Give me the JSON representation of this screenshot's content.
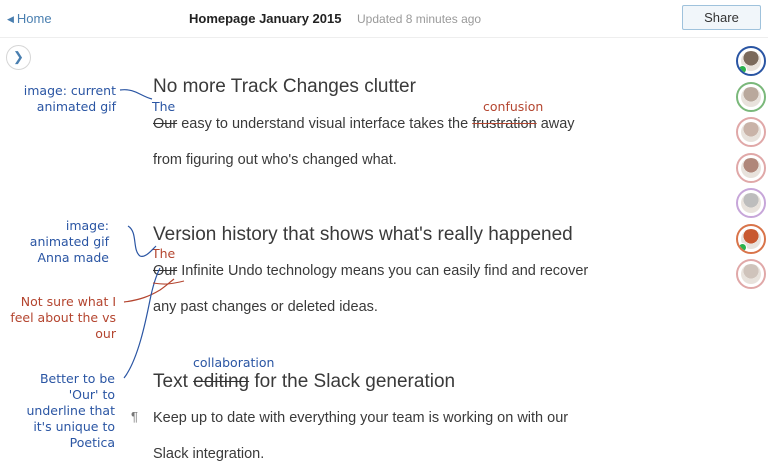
{
  "header": {
    "home_label": "Home",
    "doc_title": "Homepage January 2015",
    "updated": "Updated 8 minutes ago",
    "share_label": "Share",
    "toggle_icon": "chevron-right-icon"
  },
  "collaborators": [
    {
      "name": "avatar-1",
      "ring": "#2a55a3",
      "face": "#7b6a5c",
      "online": true
    },
    {
      "name": "avatar-2",
      "ring": "#7ab87a",
      "face": "#b9a89c",
      "online": false
    },
    {
      "name": "avatar-3",
      "ring": "#e0a8a8",
      "face": "#c9b3a8",
      "online": false
    },
    {
      "name": "avatar-4",
      "ring": "#e0a8a8",
      "face": "#b0877a",
      "online": false
    },
    {
      "name": "avatar-5",
      "ring": "#c7a6d9",
      "face": "#bdbdbd",
      "online": false
    },
    {
      "name": "avatar-6",
      "ring": "#d9744a",
      "face": "#c8582f",
      "online": true
    },
    {
      "name": "avatar-7",
      "ring": "#e0a8a8",
      "face": "#cfc3bb",
      "online": false
    }
  ],
  "sections": [
    {
      "heading": "No more Track Changes clutter",
      "line1_struck": "Our",
      "line1_mid": " easy to understand visual interface takes the ",
      "line1_struck2": "frustration",
      "line1_end": " away",
      "line2": "from figuring out who's changed what.",
      "insert_the": "The",
      "insert_word": "confusion"
    },
    {
      "heading": "Version history that shows what's really happened",
      "line1_struck": "Our",
      "line1_rest": " Infinite Undo technology means you can easily find and recover",
      "line2": "any past changes or deleted ideas.",
      "insert_the": "The"
    },
    {
      "heading_pre": "Text ",
      "heading_struck": "editing",
      "heading_post": " for the Slack generation",
      "insert_word": "collaboration",
      "line1": "Keep up to date with everything your team is working on with our",
      "line2": "Slack integration.",
      "pilcrow": "¶"
    }
  ],
  "margin_notes": {
    "note1": [
      "image: current",
      "animated gif"
    ],
    "note2": [
      "image:",
      "animated gif",
      "Anna made"
    ],
    "note3": [
      "Not sure what I",
      "feel about the vs",
      "our"
    ],
    "note4": [
      "Better to be",
      "'Our' to",
      "underline that",
      "it's unique to",
      "Poetica"
    ]
  },
  "colors": {
    "ink_blue": "#2a55a3",
    "ink_red": "#b4452f",
    "link": "#4a7fb0",
    "share_border": "#9fc2dc"
  }
}
